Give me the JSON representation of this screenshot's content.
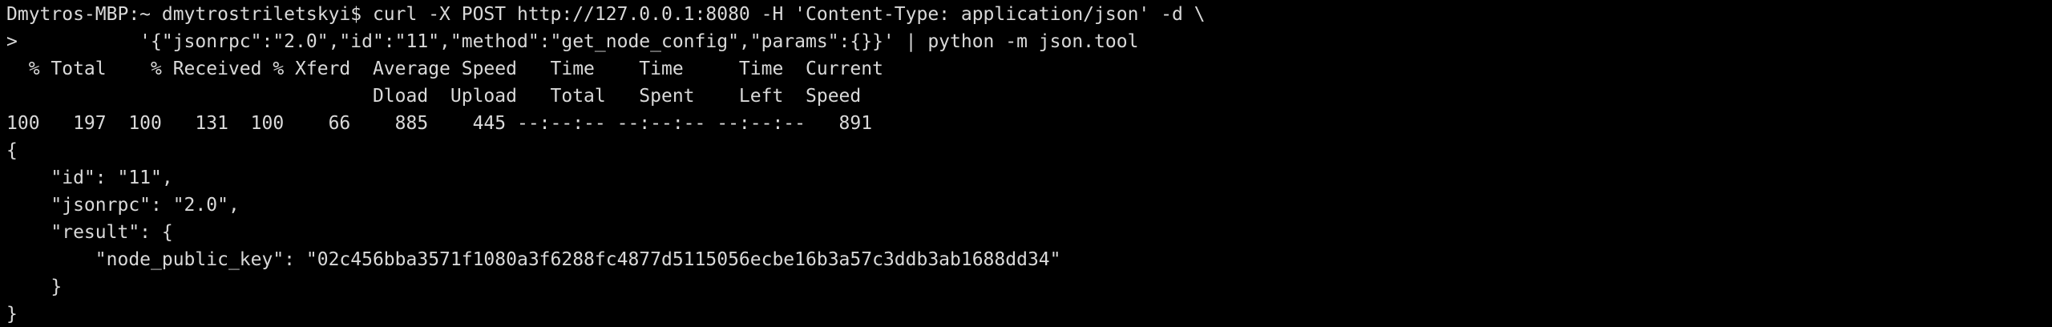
{
  "terminal": {
    "lines": [
      "Dmytros-MBP:~ dmytrostriletskyi$ curl -X POST http://127.0.0.1:8080 -H 'Content-Type: application/json' -d \\",
      ">           '{\"jsonrpc\":\"2.0\",\"id\":\"11\",\"method\":\"get_node_config\",\"params\":{}}' | python -m json.tool",
      "  % Total    % Received % Xferd  Average Speed   Time    Time     Time  Current",
      "                                 Dload  Upload   Total   Spent    Left  Speed",
      "100   197  100   131  100    66    885    445 --:--:-- --:--:-- --:--:--   891",
      "{",
      "    \"id\": \"11\",",
      "    \"jsonrpc\": \"2.0\",",
      "    \"result\": {",
      "        \"node_public_key\": \"02c456bba3571f1080a3f6288fc4877d5115056ecbe16b3a57c3ddb3ab1688dd34\"",
      "    }",
      "}"
    ]
  }
}
